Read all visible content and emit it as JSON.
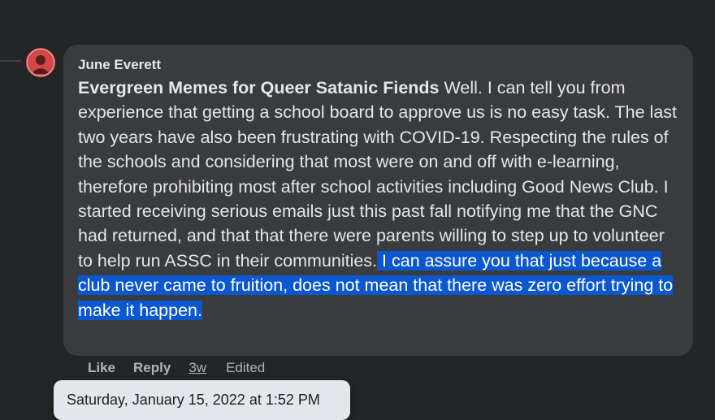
{
  "comment": {
    "author": "June Everett",
    "tag": "Evergreen Memes for Queer Satanic Fiends",
    "text": " Well. I can tell you from experience that getting a school board to approve us is no easy task. The last two years have also been frustrating with COVID-19. Respecting the rules of the schools and considering that most were on and off with e-learning, therefore prohibiting most after school activities including Good News Club. I started receiving serious emails just this past fall notifying me that the GNC had returned, and that that there were parents willing to step up to volunteer to help run ASSC in their communities.",
    "selected_text": " I can assure you that just because a club never came to fruition, does not mean that there was zero effort trying to make it happen."
  },
  "actions": {
    "like": "Like",
    "reply": "Reply",
    "time": "3w",
    "edited": "Edited"
  },
  "tooltip": {
    "text": "Saturday, January 15, 2022 at 1:52 PM"
  },
  "colors": {
    "background": "#242526",
    "bubble": "#3a3b3c",
    "selection": "#0b57d0",
    "avatar": "#c03a3a"
  }
}
